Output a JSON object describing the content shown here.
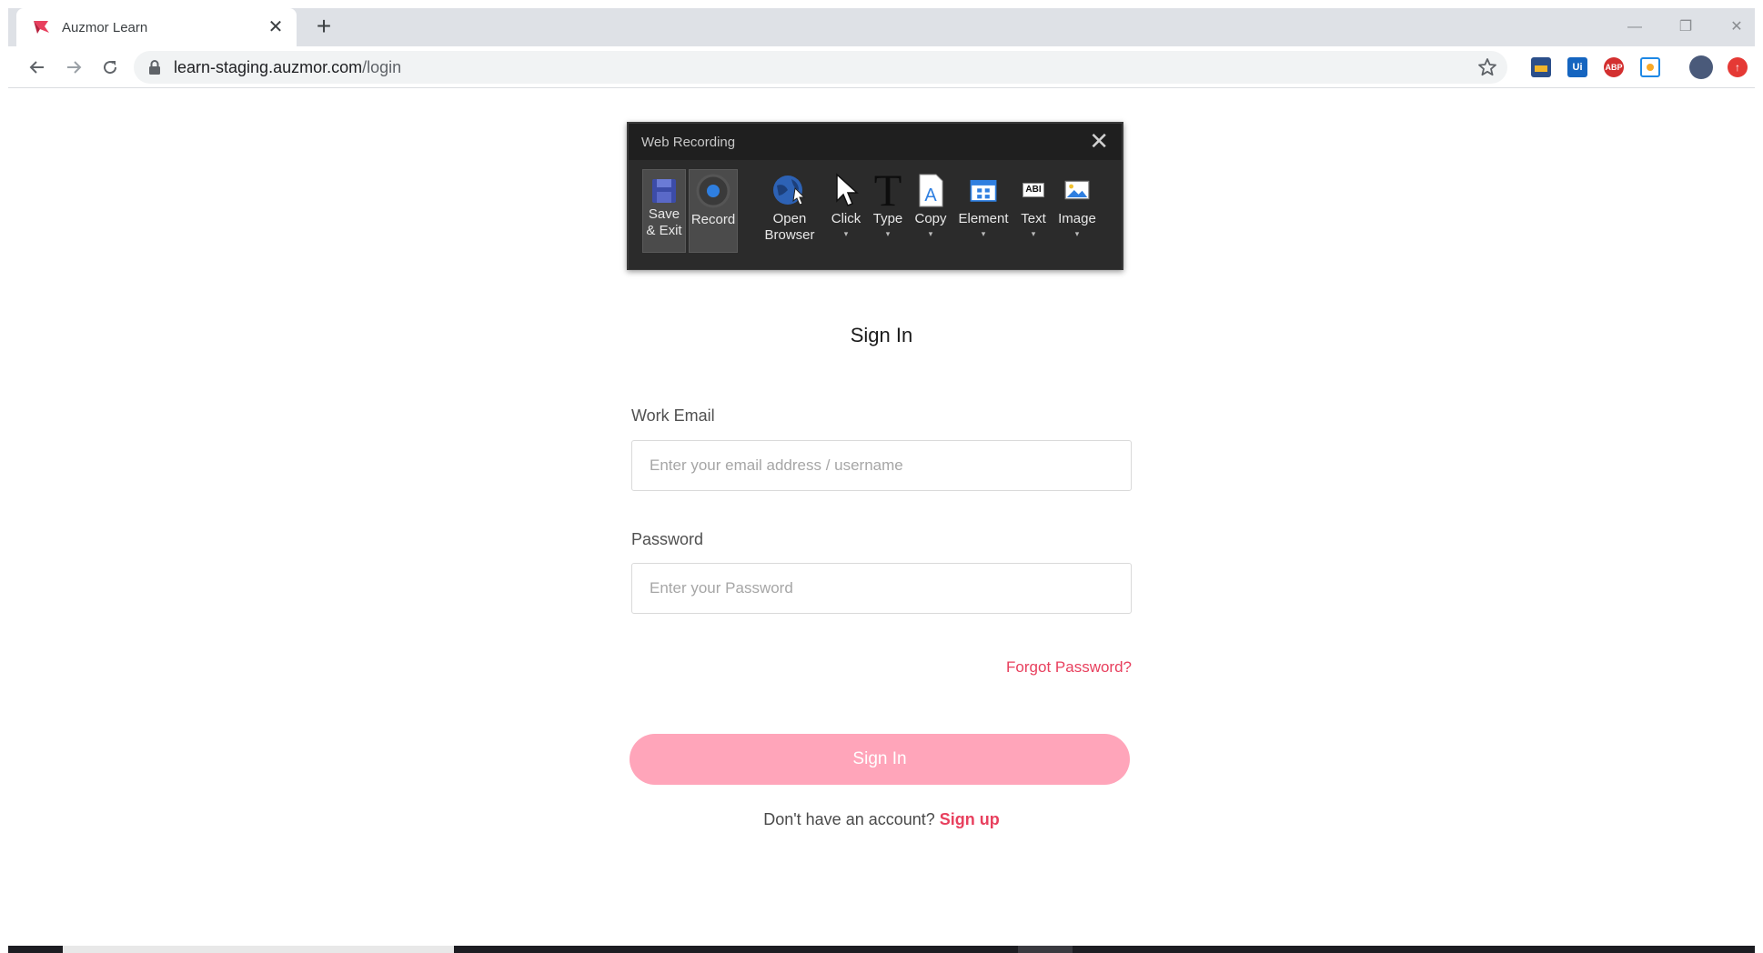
{
  "browser": {
    "tab_title": "Auzmor Learn",
    "tab_close": "✕",
    "new_tab": "+",
    "url_host": "learn-staging.auzmor.com",
    "url_path": "/login",
    "window_controls": {
      "minimize": "—",
      "restore": "❐",
      "close": "✕"
    },
    "extensions": [
      {
        "name": "extension-icon-1",
        "label": ""
      },
      {
        "name": "uipath-extension-icon",
        "label": "Ui"
      },
      {
        "name": "adblock-plus-icon",
        "label": "ABP"
      },
      {
        "name": "extension-icon-4",
        "label": ""
      }
    ]
  },
  "recorder": {
    "title": "Web Recording",
    "close": "✕",
    "buttons": {
      "save_exit": "Save\n& Exit",
      "record": "Record",
      "open_browser": "Open\nBrowser",
      "click": "Click",
      "type": "Type",
      "copy": "Copy",
      "element": "Element",
      "text": "Text",
      "image": "Image"
    },
    "caret": "▾"
  },
  "form": {
    "title": "Sign In",
    "email_label": "Work Email",
    "email_placeholder": "Enter your email address / username",
    "password_label": "Password",
    "password_placeholder": "Enter your Password",
    "forgot": "Forgot Password?",
    "submit": "Sign In",
    "signup_prompt": "Don't have an account?",
    "signup_link": "Sign up"
  },
  "colors": {
    "accent": "#e8405e",
    "submit_bg": "#ffa5ba"
  }
}
